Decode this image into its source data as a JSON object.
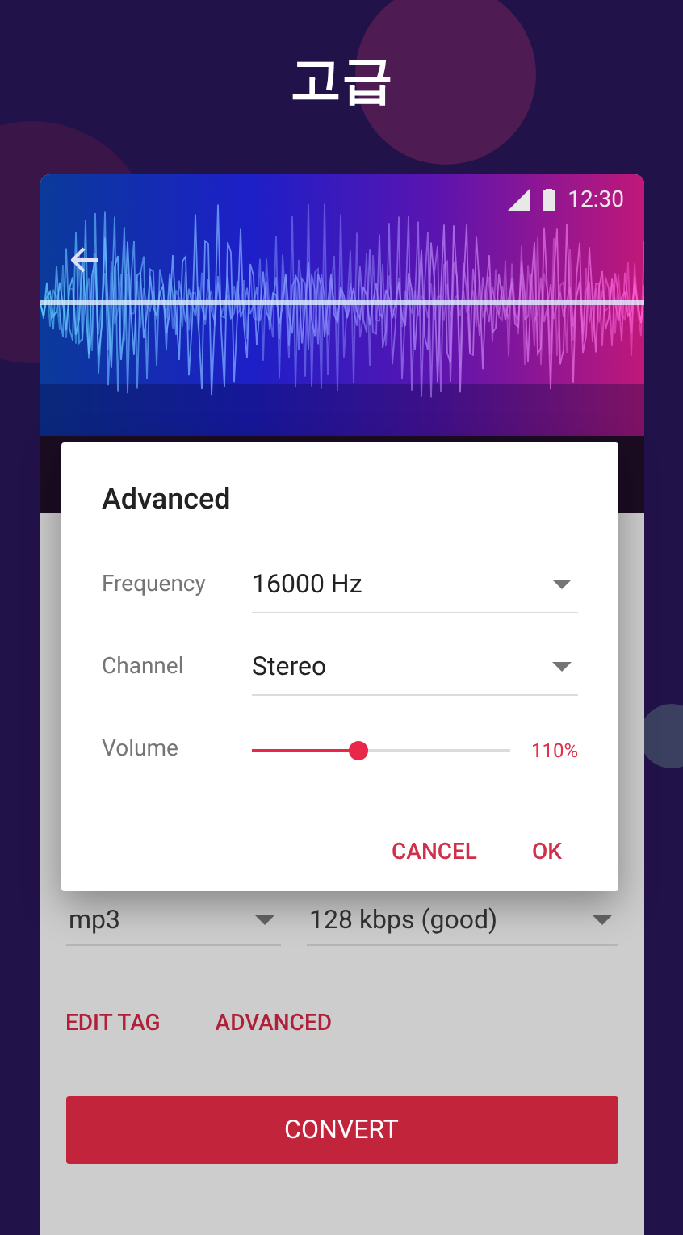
{
  "title": "고급",
  "status_bar": {
    "time": "12:30"
  },
  "dialog": {
    "title": "Advanced",
    "fields": [
      {
        "kind": "dropdown",
        "label": "Frequency",
        "value": "16000 Hz"
      },
      {
        "kind": "dropdown",
        "label": "Channel",
        "value": "Stereo"
      },
      {
        "kind": "slider",
        "label": "Volume",
        "level": 0.41,
        "reading": "110%"
      }
    ],
    "buttons": [
      "CANCEL",
      "OK"
    ]
  },
  "format": {
    "dropdowns": [
      "mp3",
      "128 kbps (good)"
    ],
    "links": [
      "EDIT TAG",
      "ADVANCED"
    ],
    "convert_button": "CONVERT"
  }
}
